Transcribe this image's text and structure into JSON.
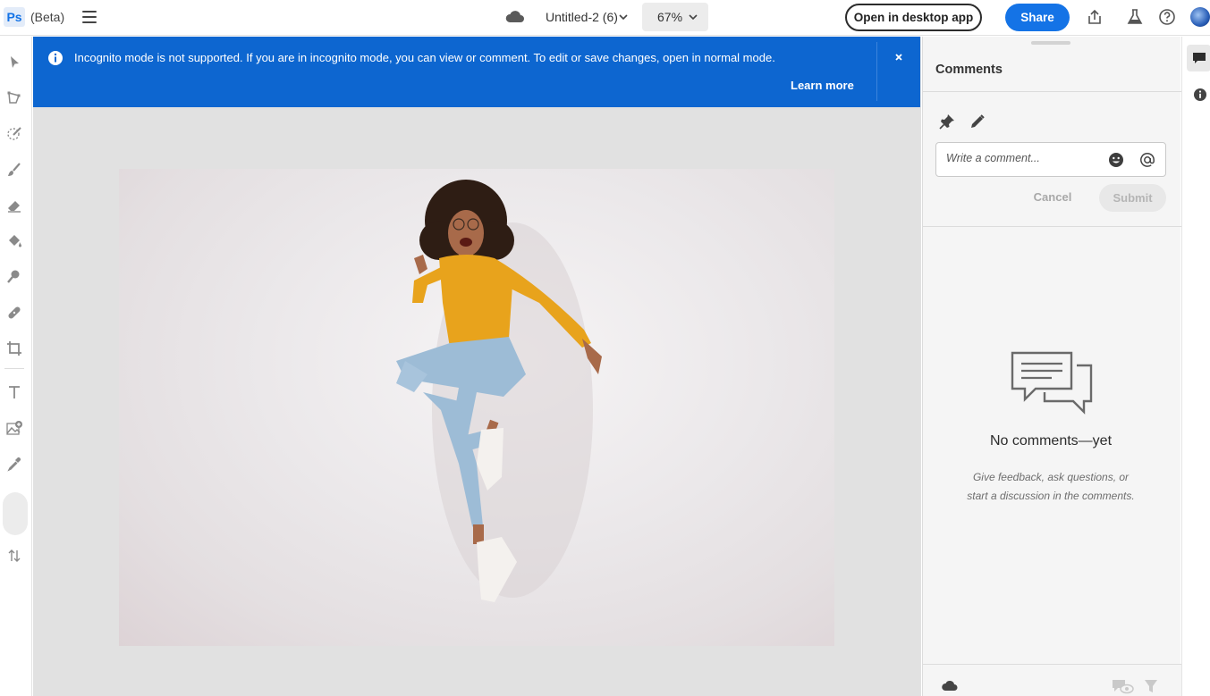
{
  "app": {
    "logo_text": "Ps",
    "beta_label": "(Beta)"
  },
  "header": {
    "doc_title": "Untitled-2 (6)",
    "zoom_value": "67%",
    "open_desktop_label": "Open in desktop app",
    "share_label": "Share"
  },
  "banner": {
    "message": "Incognito mode is not supported. If you are in incognito mode, you can view or comment. To edit or save changes, open in normal mode.",
    "learn_more": "Learn more",
    "close_glyph": "×"
  },
  "comments": {
    "title": "Comments",
    "input_placeholder": "Write a comment...",
    "cancel_label": "Cancel",
    "submit_label": "Submit",
    "empty_title": "No comments—yet",
    "empty_description": "Give feedback, ask questions, or start a discussion in the comments."
  },
  "icons": {
    "toolbar": [
      "select-icon",
      "lasso-icon",
      "quick-select-icon",
      "brush-icon",
      "eraser-icon",
      "paint-bucket-icon",
      "clone-stamp-icon",
      "healing-icon",
      "crop-icon",
      "type-icon",
      "add-image-icon",
      "eyedropper-icon",
      "swap-colors-icon"
    ],
    "header": [
      "cloud-icon",
      "export-icon",
      "labs-icon",
      "help-icon"
    ]
  },
  "colors": {
    "accent": "#1473e6",
    "banner": "#0d66d0",
    "canvas_bg": "#e1e1e1",
    "shirt": "#e8a31c",
    "jeans": "#9dbcd6"
  }
}
